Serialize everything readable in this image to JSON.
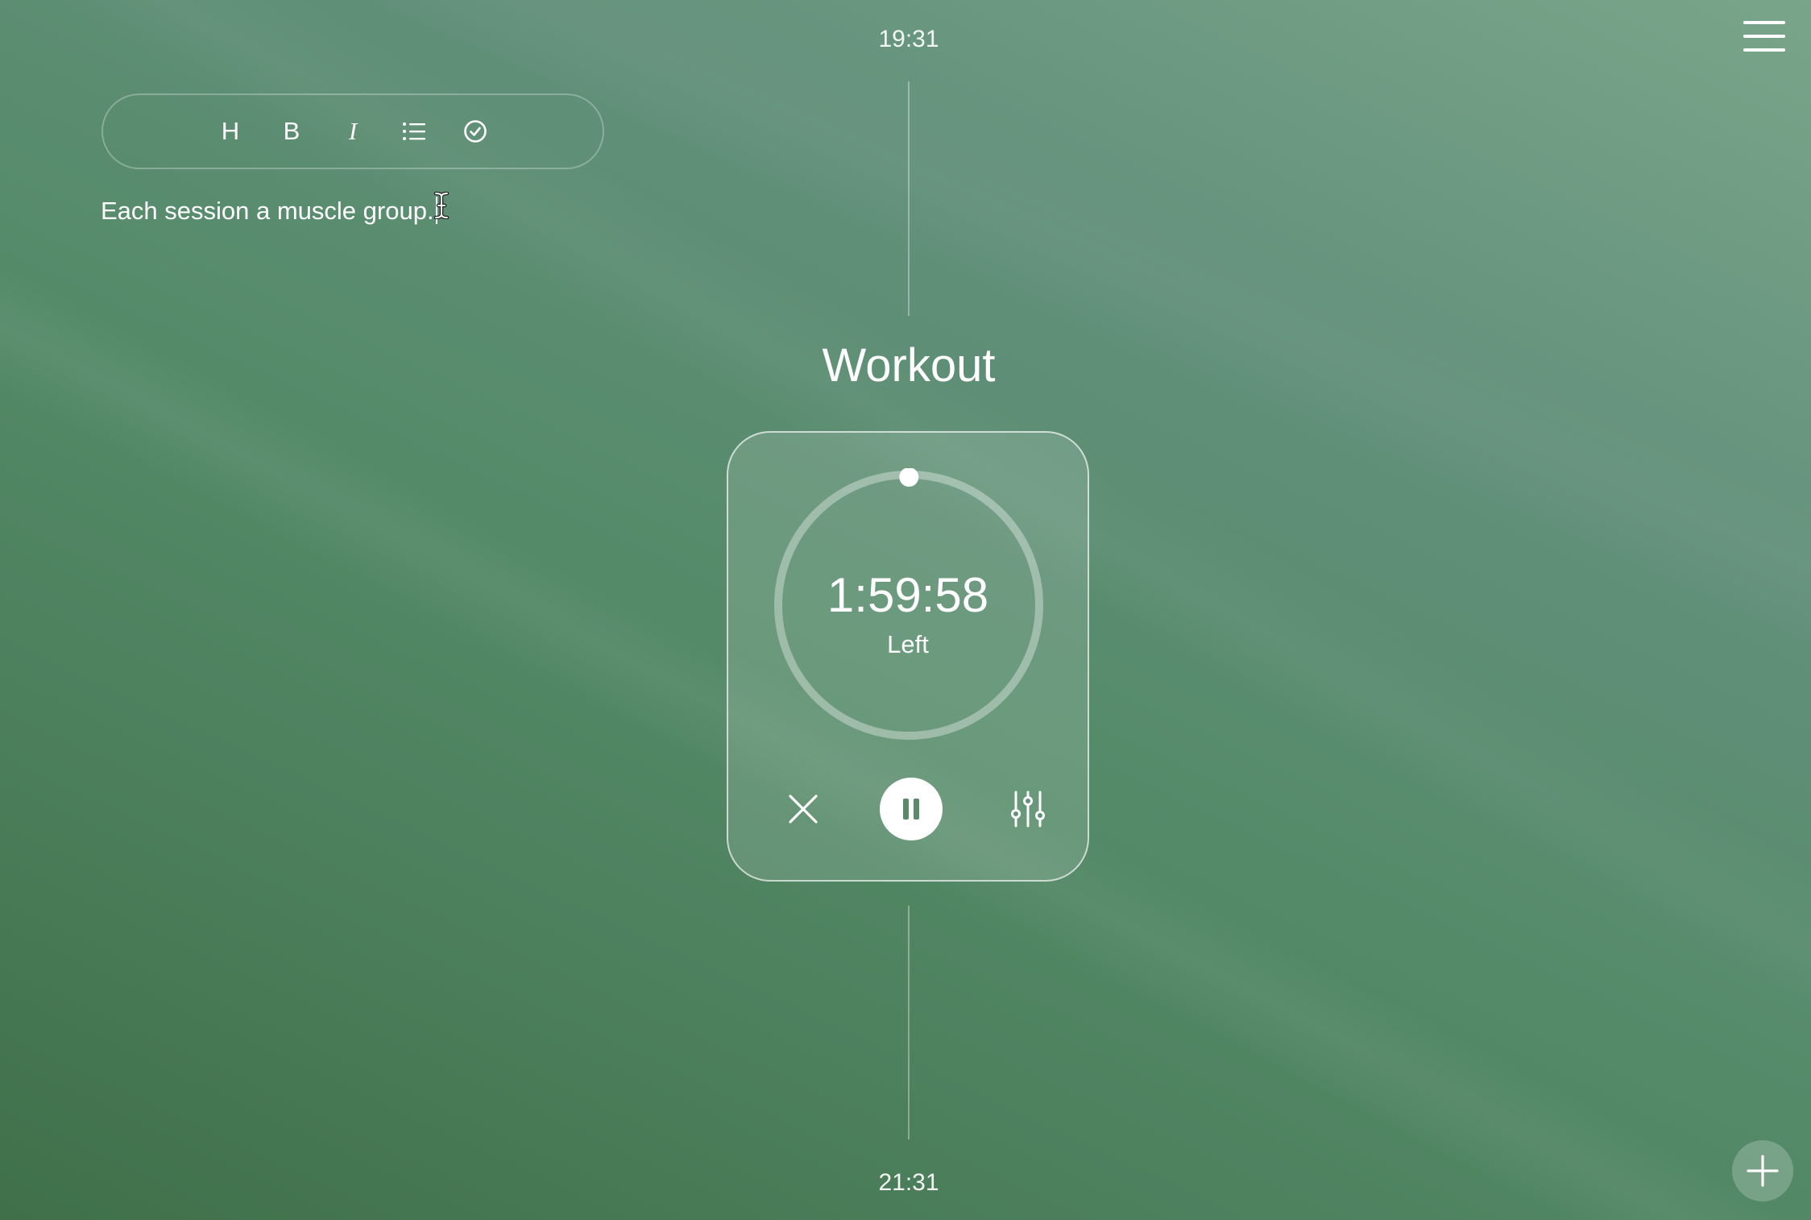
{
  "timeline": {
    "start_time": "19:31",
    "end_time": "21:31"
  },
  "toolbar": {
    "heading_label": "H",
    "bold_label": "B",
    "italic_label": "I",
    "icons": [
      "list-icon",
      "check-circle-icon"
    ]
  },
  "note": {
    "text": "Each session a muscle group."
  },
  "timer": {
    "title": "Workout",
    "remaining": "1:59:58",
    "remaining_label": "Left",
    "progress_elapsed": 0.0003,
    "icons": [
      "close-icon",
      "pause-icon",
      "sliders-icon"
    ]
  },
  "menu": {
    "icon": "hamburger-menu-icon"
  },
  "add": {
    "icon": "plus-icon"
  },
  "colors": {
    "background_top": "#79a58a",
    "background_bottom": "#3f7049",
    "foreground": "#ffffff"
  }
}
